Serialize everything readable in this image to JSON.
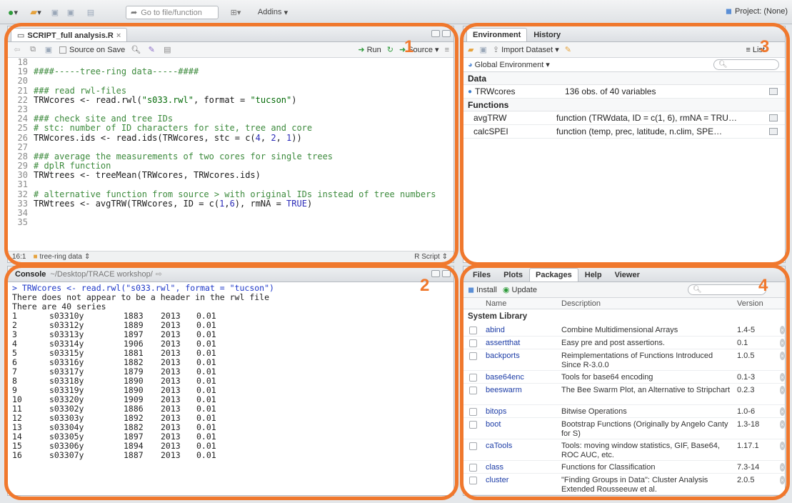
{
  "toolbar": {
    "goto_placeholder": "Go to file/function",
    "addins_label": "Addins",
    "project_label": "Project: (None)"
  },
  "editor": {
    "tab_label": "SCRIPT_full analysis.R",
    "source_on_save": "Source on Save",
    "run_label": "Run",
    "source_label": "Source",
    "status_position": "16:1",
    "status_section": "tree-ring data",
    "status_lang": "R Script",
    "lines": [
      {
        "n": "18",
        "t": ""
      },
      {
        "n": "19",
        "t": "####-----tree-ring data-----####"
      },
      {
        "n": "20",
        "t": ""
      },
      {
        "n": "21",
        "t": "### read rwl-files"
      },
      {
        "n": "22",
        "t": "TRWcores <- read.rwl(\"s033.rwl\", format = \"tucson\")"
      },
      {
        "n": "23",
        "t": ""
      },
      {
        "n": "24",
        "t": "### check site and tree IDs"
      },
      {
        "n": "25",
        "t": "# stc: number of ID characters for site, tree and core"
      },
      {
        "n": "26",
        "t": "TRWcores.ids <- read.ids(TRWcores, stc = c(4, 2, 1))"
      },
      {
        "n": "27",
        "t": ""
      },
      {
        "n": "28",
        "t": "### average the measurements of two cores for single trees"
      },
      {
        "n": "29",
        "t": "# dplR function"
      },
      {
        "n": "30",
        "t": "TRWtrees <- treeMean(TRWcores, TRWcores.ids)"
      },
      {
        "n": "31",
        "t": ""
      },
      {
        "n": "32",
        "t": "# alternative function from source > with original IDs instead of tree numbers"
      },
      {
        "n": "33",
        "t": "TRWtrees <- avgTRW(TRWcores, ID = c(1,6), rmNA = TRUE)"
      },
      {
        "n": "34",
        "t": ""
      },
      {
        "n": "35",
        "t": ""
      }
    ]
  },
  "console": {
    "tab_label": "Console",
    "path": "~/Desktop/TRACE workshop/",
    "command": "> TRWcores <- read.rwl(\"s033.rwl\", format = \"tucson\")",
    "msg1": "There does not appear to be a header in the rwl file",
    "msg2": "There are 40 series",
    "rows": [
      [
        "1",
        "s03310y",
        "1883",
        "2013",
        "0.01"
      ],
      [
        "2",
        "s03312y",
        "1889",
        "2013",
        "0.01"
      ],
      [
        "3",
        "s03313y",
        "1897",
        "2013",
        "0.01"
      ],
      [
        "4",
        "s03314y",
        "1906",
        "2013",
        "0.01"
      ],
      [
        "5",
        "s03315y",
        "1881",
        "2013",
        "0.01"
      ],
      [
        "6",
        "s03316y",
        "1882",
        "2013",
        "0.01"
      ],
      [
        "7",
        "s03317y",
        "1879",
        "2013",
        "0.01"
      ],
      [
        "8",
        "s03318y",
        "1890",
        "2013",
        "0.01"
      ],
      [
        "9",
        "s03319y",
        "1890",
        "2013",
        "0.01"
      ],
      [
        "10",
        "s03320y",
        "1909",
        "2013",
        "0.01"
      ],
      [
        "11",
        "s03302y",
        "1886",
        "2013",
        "0.01"
      ],
      [
        "12",
        "s03303y",
        "1892",
        "2013",
        "0.01"
      ],
      [
        "13",
        "s03304y",
        "1882",
        "2013",
        "0.01"
      ],
      [
        "14",
        "s03305y",
        "1897",
        "2013",
        "0.01"
      ],
      [
        "15",
        "s03306y",
        "1894",
        "2013",
        "0.01"
      ],
      [
        "16",
        "s03307y",
        "1887",
        "2013",
        "0.01"
      ]
    ]
  },
  "environment": {
    "tabs": [
      "Environment",
      "History"
    ],
    "import_label": "Import Dataset",
    "list_label": "List",
    "scope_label": "Global Environment",
    "data_header": "Data",
    "functions_header": "Functions",
    "data_rows": [
      {
        "name": "TRWcores",
        "value": "136 obs. of 40 variables"
      }
    ],
    "function_rows": [
      {
        "name": "avgTRW",
        "value": "function (TRWdata, ID = c(1, 6), rmNA = TRU…"
      },
      {
        "name": "calcSPEI",
        "value": "function (temp, prec, latitude, n.clim, SPE…"
      }
    ]
  },
  "packages": {
    "tabs": [
      "Files",
      "Plots",
      "Packages",
      "Help",
      "Viewer"
    ],
    "install_label": "Install",
    "update_label": "Update",
    "col_name": "Name",
    "col_desc": "Description",
    "col_ver": "Version",
    "section": "System Library",
    "rows": [
      {
        "name": "abind",
        "desc": "Combine Multidimensional Arrays",
        "ver": "1.4-5"
      },
      {
        "name": "assertthat",
        "desc": "Easy pre and post assertions.",
        "ver": "0.1"
      },
      {
        "name": "backports",
        "desc": "Reimplementations of Functions Introduced Since R-3.0.0",
        "ver": "1.0.5"
      },
      {
        "name": "base64enc",
        "desc": "Tools for base64 encoding",
        "ver": "0.1-3"
      },
      {
        "name": "beeswarm",
        "desc": "The Bee Swarm Plot, an Alternative to Stripchart",
        "ver": "0.2.3"
      },
      {
        "name": "bitops",
        "desc": "Bitwise Operations",
        "ver": "1.0-6"
      },
      {
        "name": "boot",
        "desc": "Bootstrap Functions (Originally by Angelo Canty for S)",
        "ver": "1.3-18"
      },
      {
        "name": "caTools",
        "desc": "Tools: moving window statistics, GIF, Base64, ROC AUC, etc.",
        "ver": "1.17.1"
      },
      {
        "name": "class",
        "desc": "Functions for Classification",
        "ver": "7.3-14"
      },
      {
        "name": "cluster",
        "desc": "\"Finding Groups in Data\": Cluster Analysis Extended Rousseeuw et al.",
        "ver": "2.0.5"
      }
    ]
  },
  "annotations": {
    "n1": "1",
    "n2": "2",
    "n3": "3",
    "n4": "4"
  },
  "colors": {
    "accent": "#f0782d",
    "comment": "#3c8a3c",
    "prompt": "#1e38c9"
  }
}
